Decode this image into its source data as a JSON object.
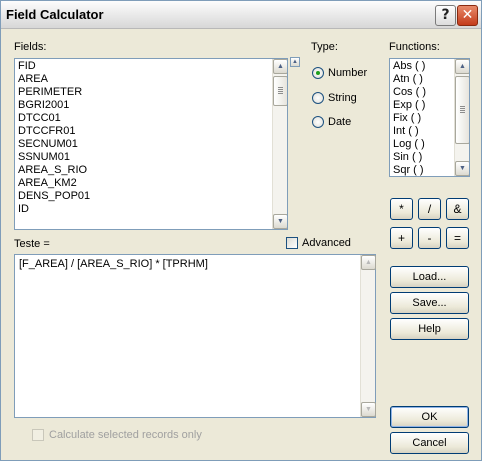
{
  "window": {
    "title": "Field Calculator"
  },
  "fields": {
    "label": "Fields:",
    "items": [
      "FID",
      "AREA",
      "PERIMETER",
      "BGRI2001",
      "DTCC01",
      "DTCCFR01",
      "SECNUM01",
      "SSNUM01",
      "AREA_S_RIO",
      "AREA_KM2",
      "DENS_POP01",
      "ID"
    ]
  },
  "type": {
    "label": "Type:",
    "options": [
      "Number",
      "String",
      "Date"
    ],
    "selected": "Number"
  },
  "functions": {
    "label": "Functions:",
    "items": [
      "Abs ( )",
      "Atn ( )",
      "Cos ( )",
      "Exp ( )",
      "Fix ( )",
      "Int ( )",
      "Log ( )",
      "Sin ( )",
      "Sqr ( )"
    ]
  },
  "operators": [
    "*",
    "/",
    "&",
    "+",
    "-",
    "="
  ],
  "expression": {
    "label": "Teste =",
    "value": "[F_AREA] / [AREA_S_RIO] * [TPRHM]"
  },
  "advanced": {
    "label": "Advanced",
    "checked": false
  },
  "buttons": {
    "load": "Load...",
    "save": "Save...",
    "help": "Help",
    "ok": "OK",
    "cancel": "Cancel"
  },
  "selected_only": {
    "label": "Calculate selected records only",
    "checked": false,
    "enabled": false
  },
  "icons": {
    "help": "?",
    "close": "✕",
    "scroll_up": "▲",
    "scroll_down": "▼"
  }
}
